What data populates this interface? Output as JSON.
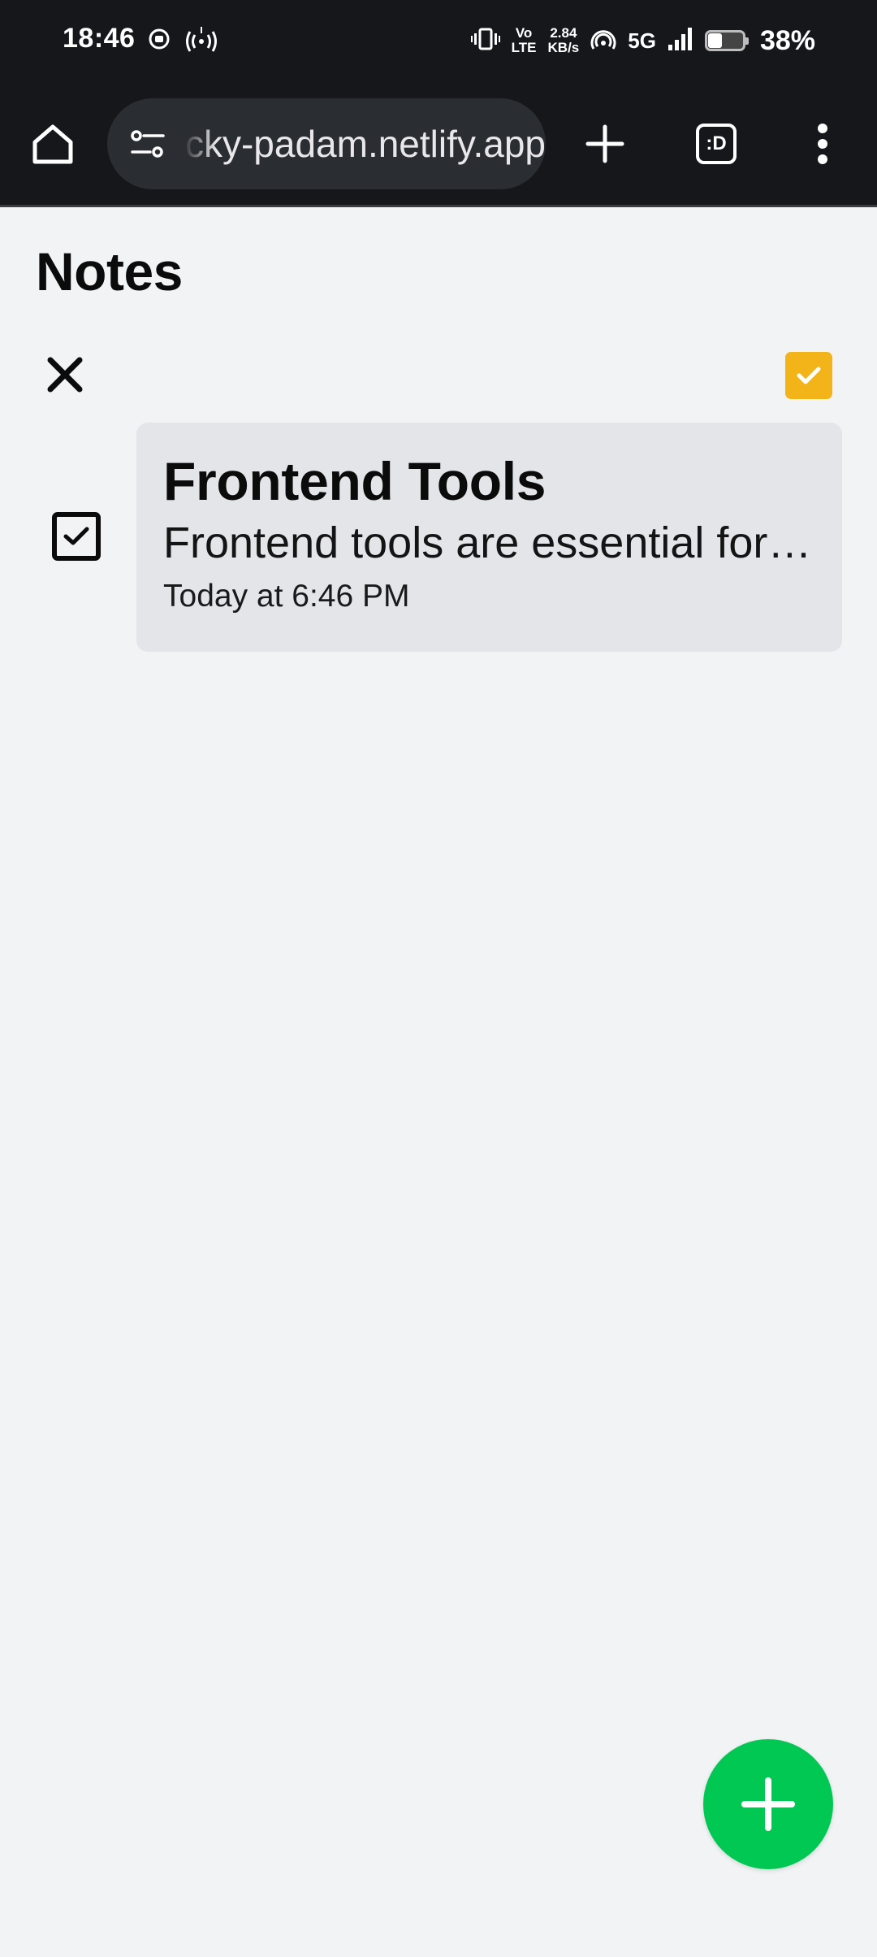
{
  "status_bar": {
    "time": "18:46",
    "network_speed_value": "2.84",
    "network_speed_unit": "KB/s",
    "volte_line1": "Vo",
    "volte_line2": "LTE",
    "network_type": "5G",
    "battery_percent_label": "38%",
    "battery_level": 0.38
  },
  "browser": {
    "url": "sticky-padam.netlify.app",
    "tab_count": ":D"
  },
  "page": {
    "title": "Notes"
  },
  "notes": [
    {
      "title": "Frontend Tools",
      "body": "Frontend tools are essential for building modern web apps",
      "timestamp": "Today at 6:46 PM",
      "selected": true
    }
  ],
  "colors": {
    "chrome_bg": "#15171b",
    "page_bg": "#f2f3f5",
    "card_bg": "#e4e5e8",
    "select_all_accent": "#f2b418",
    "fab_accent": "#00c853"
  }
}
